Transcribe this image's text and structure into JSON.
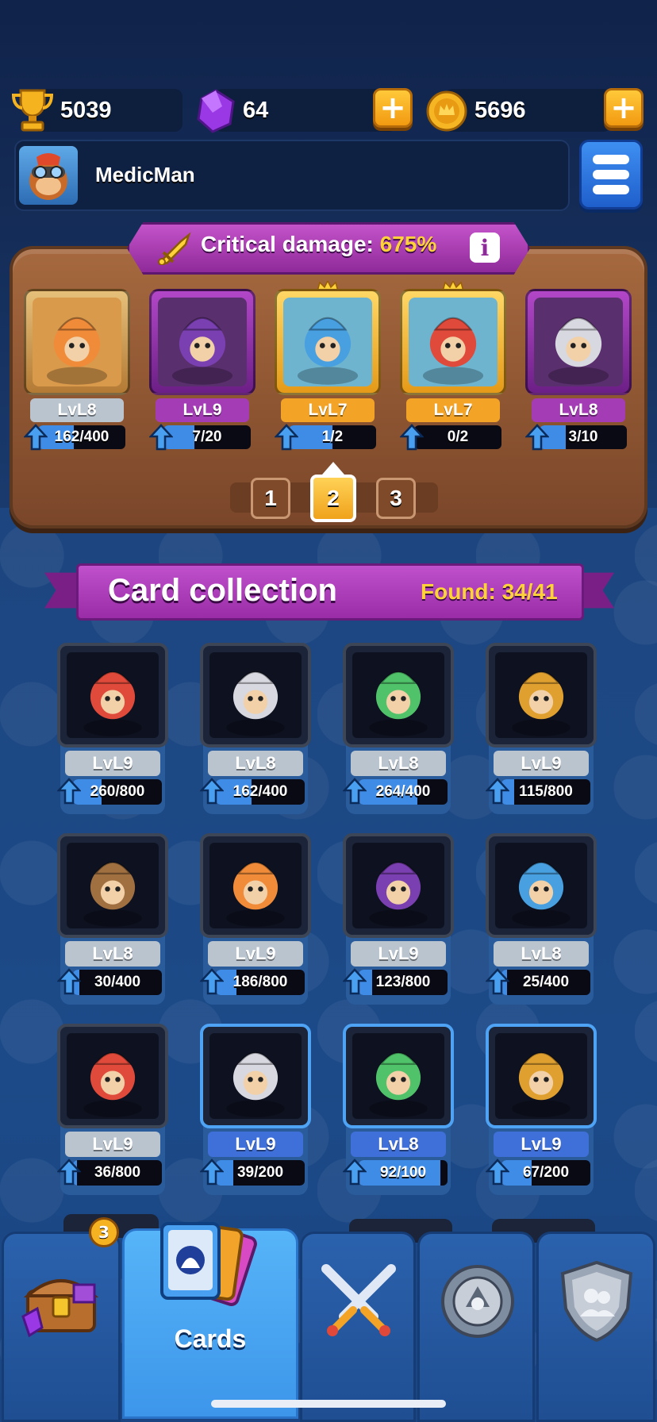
{
  "resources": {
    "trophies": "5039",
    "gems": "64",
    "coins": "5696"
  },
  "profile": {
    "username": "MedicMan"
  },
  "deck": {
    "stat_label": "Critical damage:",
    "stat_value": "675%",
    "cards": [
      {
        "level": "LvL8",
        "progress": "162/400",
        "fill": 0.405,
        "rarity": "common"
      },
      {
        "level": "LvL9",
        "progress": "7/20",
        "fill": 0.35,
        "rarity": "epic"
      },
      {
        "level": "LvL7",
        "progress": "1/2",
        "fill": 0.5,
        "rarity": "legendary"
      },
      {
        "level": "LvL7",
        "progress": "0/2",
        "fill": 0.0,
        "rarity": "legendary"
      },
      {
        "level": "LvL8",
        "progress": "3/10",
        "fill": 0.3,
        "rarity": "epic"
      }
    ],
    "pages": [
      "1",
      "2",
      "3"
    ],
    "active_page": "2"
  },
  "collection": {
    "title": "Card collection",
    "found": "Found: 34/41",
    "cards": [
      {
        "level": "LvL9",
        "progress": "260/800",
        "fill": 0.325,
        "rarity": "common"
      },
      {
        "level": "LvL8",
        "progress": "162/400",
        "fill": 0.405,
        "rarity": "common"
      },
      {
        "level": "LvL8",
        "progress": "264/400",
        "fill": 0.66,
        "rarity": "common"
      },
      {
        "level": "LvL9",
        "progress": "115/800",
        "fill": 0.144,
        "rarity": "common"
      },
      {
        "level": "LvL8",
        "progress": "30/400",
        "fill": 0.075,
        "rarity": "common"
      },
      {
        "level": "LvL9",
        "progress": "186/800",
        "fill": 0.233,
        "rarity": "common"
      },
      {
        "level": "LvL9",
        "progress": "123/800",
        "fill": 0.154,
        "rarity": "common"
      },
      {
        "level": "LvL8",
        "progress": "25/400",
        "fill": 0.063,
        "rarity": "common"
      },
      {
        "level": "LvL9",
        "progress": "36/800",
        "fill": 0.045,
        "rarity": "common"
      },
      {
        "level": "LvL9",
        "progress": "39/200",
        "fill": 0.195,
        "rarity": "rare"
      },
      {
        "level": "LvL8",
        "progress": "92/100",
        "fill": 0.92,
        "rarity": "rare"
      },
      {
        "level": "LvL9",
        "progress": "67/200",
        "fill": 0.335,
        "rarity": "rare"
      }
    ]
  },
  "tabs": {
    "shop_badge": "3",
    "cards_label": "Cards"
  },
  "colors": {
    "common_label": "#b9c4cf",
    "epic_label": "#a43cb6",
    "legendary_label": "#f3a326",
    "rare_label": "#3f6fd8",
    "progress_fill": "#3f8ce6"
  }
}
